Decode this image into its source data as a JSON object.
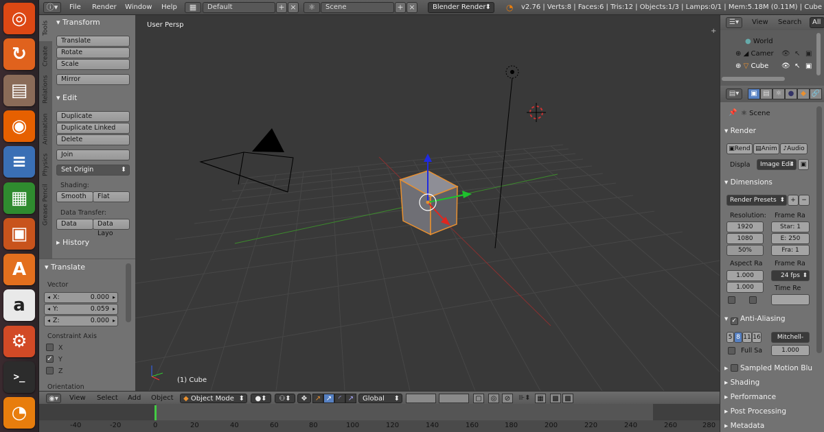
{
  "launcher": {
    "items": [
      {
        "name": "ubuntu-dash-icon",
        "color": "#dd4814",
        "glyph": "◎"
      },
      {
        "name": "software-updater-icon",
        "color": "#e0621d",
        "glyph": "↻"
      },
      {
        "name": "files-icon",
        "color": "#8a6b58",
        "glyph": "▤"
      },
      {
        "name": "firefox-icon",
        "color": "#e66000",
        "glyph": "◉"
      },
      {
        "name": "libreoffice-writer-icon",
        "color": "#3a6fb5",
        "glyph": "≡"
      },
      {
        "name": "libreoffice-calc-icon",
        "color": "#2f8b2f",
        "glyph": "▦"
      },
      {
        "name": "libreoffice-impress-icon",
        "color": "#c8531c",
        "glyph": "▣"
      },
      {
        "name": "ubuntu-software-center-icon",
        "color": "#e36f1e",
        "glyph": "A"
      },
      {
        "name": "amazon-icon",
        "color": "#e9e9e9",
        "glyph": "a"
      },
      {
        "name": "system-settings-icon",
        "color": "#d24a26",
        "glyph": "⚙"
      },
      {
        "name": "terminal-icon",
        "color": "#2c2c2c",
        "glyph": ">_"
      },
      {
        "name": "blender-icon",
        "color": "#e87d0d",
        "glyph": "◔"
      }
    ]
  },
  "menubar": {
    "menus": [
      "File",
      "Render",
      "Window",
      "Help"
    ],
    "layout": "Default",
    "scene": "Scene",
    "engine": "Blender Render",
    "stats": "v2.76 | Verts:8 | Faces:6 | Tris:12 | Objects:1/3 | Lamps:0/1 | Mem:5.18M (0.11M) | Cube"
  },
  "toolshelf": {
    "tabs": [
      "Tools",
      "Create",
      "Relations",
      "Animation",
      "Physics",
      "Grease Pencil"
    ],
    "transform_title": "Transform",
    "translate": "Translate",
    "rotate": "Rotate",
    "scale": "Scale",
    "mirror": "Mirror",
    "edit_title": "Edit",
    "duplicate": "Duplicate",
    "duplicate_linked": "Duplicate Linked",
    "delete": "Delete",
    "join": "Join",
    "set_origin": "Set Origin",
    "shading_label": "Shading:",
    "smooth": "Smooth",
    "flat": "Flat",
    "data_transfer_label": "Data Transfer:",
    "data": "Data",
    "data_layo": "Data Layo",
    "history_title": "History"
  },
  "operator": {
    "title": "Translate",
    "vector_label": "Vector",
    "x_label": "X:",
    "x_value": "0.000",
    "y_label": "Y:",
    "y_value": "0.059",
    "z_label": "Z:",
    "z_value": "0.000",
    "constraint_label": "Constraint Axis",
    "axes": [
      {
        "label": "X",
        "checked": false
      },
      {
        "label": "Y",
        "checked": true
      },
      {
        "label": "Z",
        "checked": false
      }
    ],
    "orientation_label": "Orientation"
  },
  "viewport": {
    "view_name": "User Persp",
    "object_label": "(1) Cube"
  },
  "viewport_header": {
    "view": "View",
    "select": "Select",
    "add": "Add",
    "object": "Object",
    "mode": "Object Mode",
    "orientation": "Global"
  },
  "timeline": {
    "ticks": [
      "-40",
      "-20",
      "0",
      "20",
      "40",
      "60",
      "80",
      "100",
      "120",
      "140",
      "160",
      "180",
      "200",
      "220",
      "240",
      "260",
      "280"
    ]
  },
  "outliner": {
    "view": "View",
    "search": "Search",
    "all_scenes": "All S",
    "items": [
      "World",
      "Camer",
      "Cube"
    ]
  },
  "properties": {
    "scene": "Scene",
    "render_title": "Render",
    "render_btn": "Rend",
    "anim_btn": "Anim",
    "audio_btn": "Audio",
    "display_label": "Displa",
    "display_value": "Image Edi",
    "dimensions_title": "Dimensions",
    "render_presets": "Render Presets",
    "resolution_label": "Resolution:",
    "frame_range_label": "Frame Ra",
    "res_x": "1920",
    "res_y": "1080",
    "res_pct": "50%",
    "start": "Star: 1",
    "end": "E: 250",
    "frame": "Fra: 1",
    "aspect_label": "Aspect Ra",
    "frame_rate_label": "Frame Ra",
    "aspect_x": "1.000",
    "aspect_y": "1.000",
    "fps": "24 fps",
    "time_remap": "Time Re",
    "aa_title": "Anti-Aliasing",
    "aa_samples": [
      "5",
      "8",
      "11",
      "16"
    ],
    "aa_filter": "Mitchell-",
    "full_sample": "Full Sa",
    "aa_size": "1.000",
    "motion_blur": "Sampled Motion Blu",
    "shading": "Shading",
    "performance": "Performance",
    "post_processing": "Post Processing",
    "metadata": "Metadata"
  }
}
